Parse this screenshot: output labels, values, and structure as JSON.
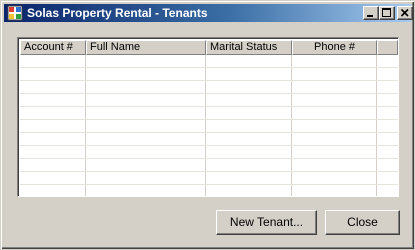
{
  "window": {
    "title": "Solas Property Rental - Tenants",
    "icon": "app-window-icon"
  },
  "caption_buttons": {
    "minimize_icon": "minimize-icon",
    "maximize_icon": "maximize-icon",
    "close_icon": "close-icon"
  },
  "tenants_list": {
    "columns": [
      {
        "label": "Account #",
        "align": "left"
      },
      {
        "label": "Full Name",
        "align": "left"
      },
      {
        "label": "Marital Status",
        "align": "left"
      },
      {
        "label": "Phone #",
        "align": "center"
      }
    ],
    "rows": []
  },
  "buttons": {
    "new_tenant": "New Tenant...",
    "close": "Close"
  }
}
